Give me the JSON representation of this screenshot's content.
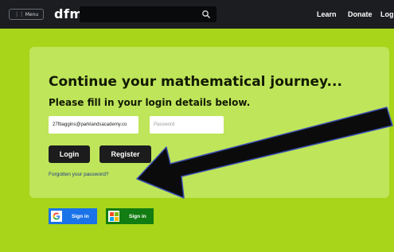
{
  "header": {
    "menu_label": "Menu",
    "logo": "dfm",
    "nav": [
      "Learn",
      "Donate",
      "Login"
    ]
  },
  "login": {
    "headline": "Continue your mathematical journey...",
    "subheading": "Please fill in your login details below.",
    "email_value": "27fbaggins@parklandsacademy.co",
    "password_placeholder": "Password",
    "login_label": "Login",
    "register_label": "Register",
    "forgot_label": "Forgotten your password?"
  },
  "sso": {
    "google_label": "Sign in",
    "microsoft_label": "Sign in"
  },
  "colors": {
    "background": "#a8d41a",
    "panel": "#bfe55a",
    "topbar": "#1b1d20",
    "google_blue": "#1a73e8",
    "microsoft_green": "#127d12"
  }
}
